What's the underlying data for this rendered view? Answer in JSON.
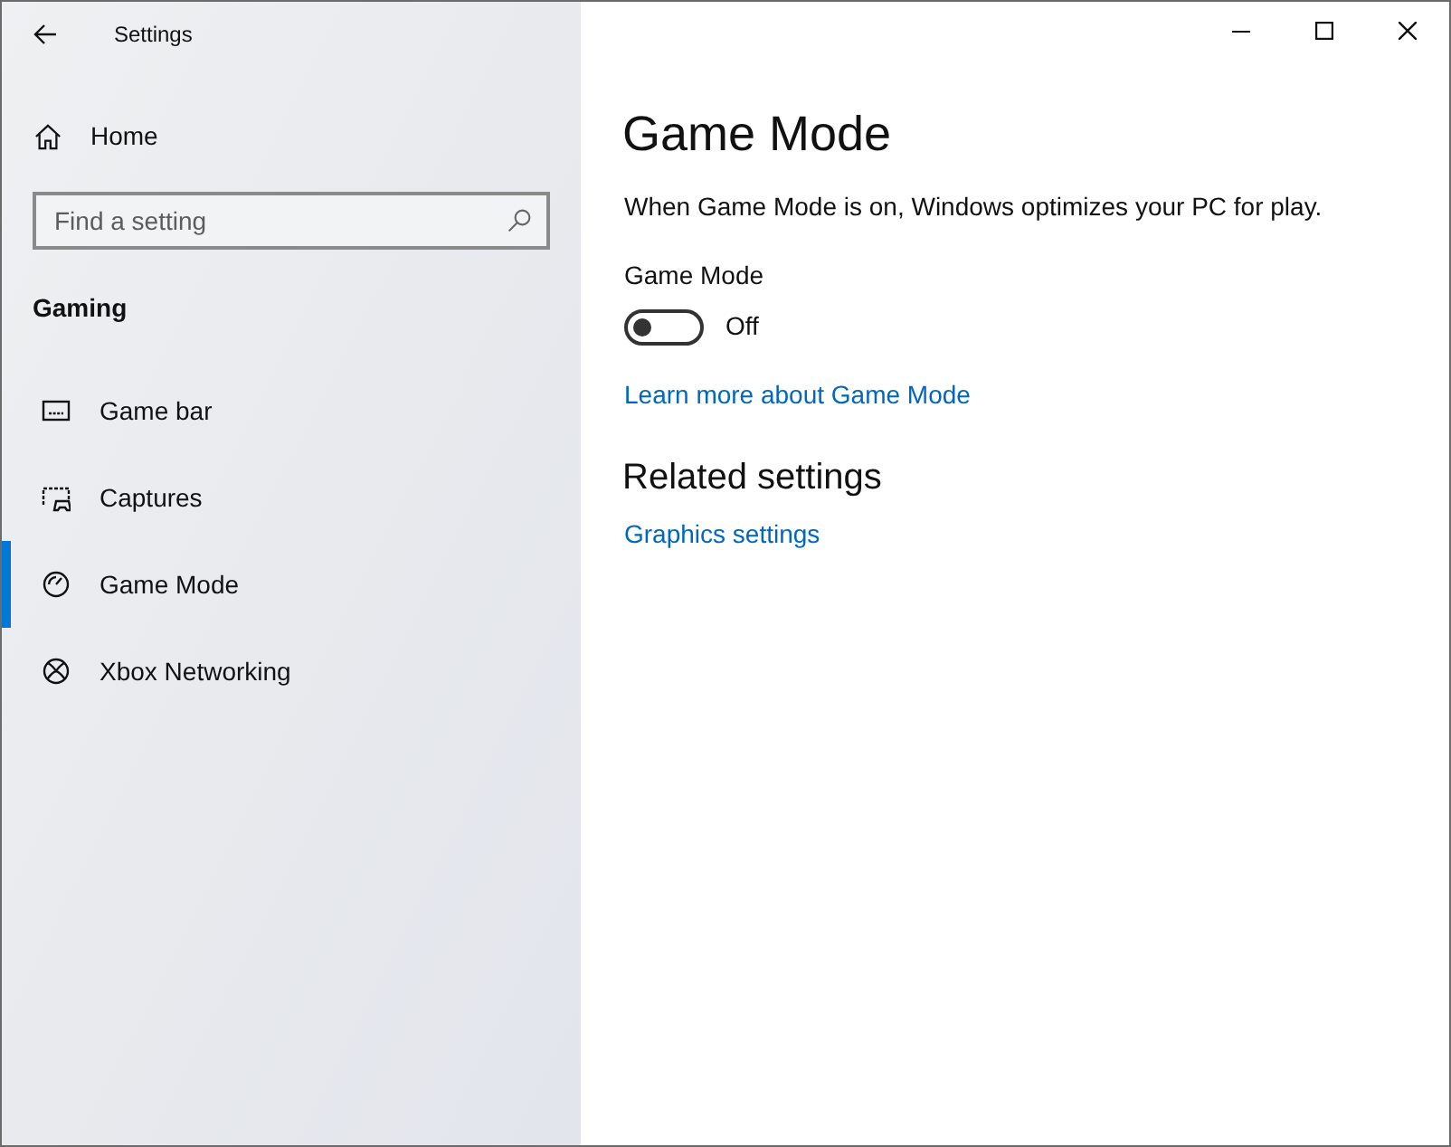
{
  "window": {
    "title": "Settings"
  },
  "sidebar": {
    "home": "Home",
    "search": {
      "placeholder": "Find a setting"
    },
    "section": "Gaming",
    "items": [
      {
        "label": "Game bar",
        "kind": "gamebar",
        "selected": false
      },
      {
        "label": "Captures",
        "kind": "captures",
        "selected": false
      },
      {
        "label": "Game Mode",
        "kind": "gauge",
        "selected": true
      },
      {
        "label": "Xbox Networking",
        "kind": "xbox",
        "selected": false
      }
    ]
  },
  "page": {
    "title": "Game Mode",
    "description": "When Game Mode is on, Windows optimizes your PC for play.",
    "toggle": {
      "label": "Game Mode",
      "on": false,
      "state_text": "Off"
    },
    "link": "Learn more about Game Mode",
    "related_title": "Related settings",
    "related_links": [
      "Graphics settings"
    ]
  }
}
